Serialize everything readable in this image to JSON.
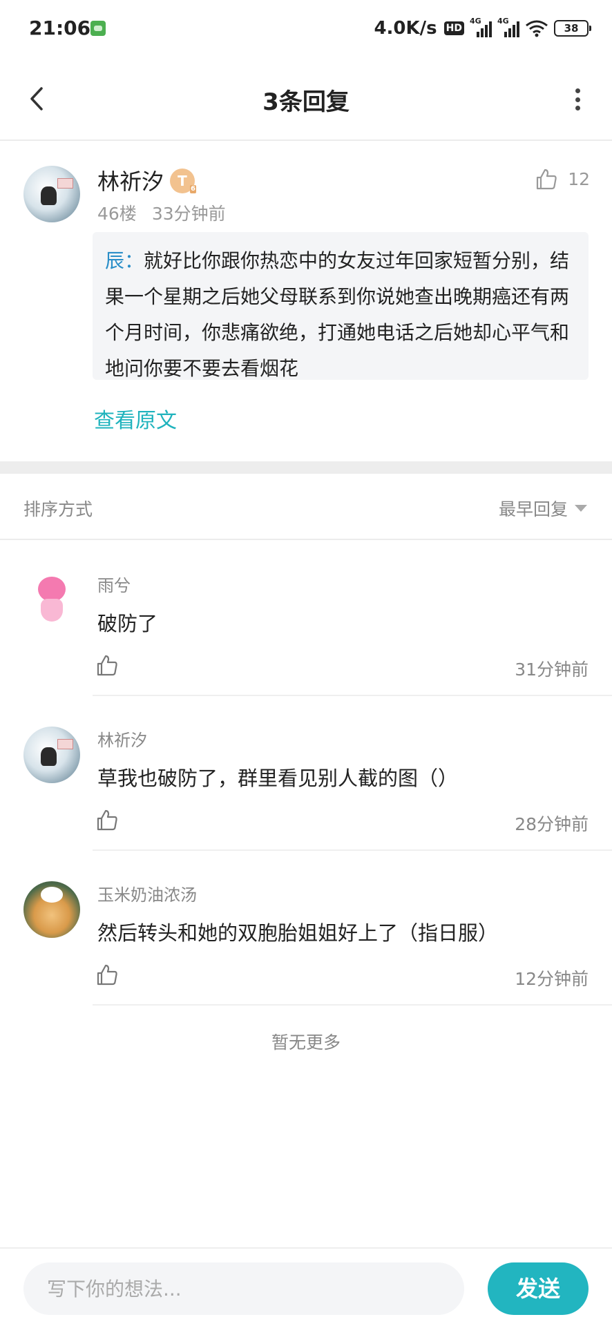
{
  "status_bar": {
    "time": "21:06",
    "net_speed": "4.0K/s",
    "hd_label": "HD",
    "signal_1_label": "4G",
    "signal_2_label": "4G",
    "battery": "38",
    "icons": [
      "app-notification-icon",
      "hd-icon",
      "signal-icon",
      "signal-icon",
      "wifi-icon",
      "battery-icon"
    ]
  },
  "header": {
    "title": "3条回复",
    "back_icon": "chevron-left-icon",
    "more_icon": "more-vertical-icon"
  },
  "post": {
    "author": "林祈汐",
    "level_badge": "T",
    "level_sub": "6",
    "floor": "46楼",
    "time": "33分钟前",
    "like_count": "12",
    "quote_name": "辰：",
    "quote_text": "就好比你跟你热恋中的女友过年回家短暂分别，结果一个星期之后她父母联系到你说她查出晚期癌还有两个月时间，你悲痛欲绝，打通她电话之后她却心平气和地问你要不要去看烟花",
    "view_original": "查看原文"
  },
  "sort": {
    "label": "排序方式",
    "selected": "最早回复"
  },
  "replies": [
    {
      "name": "雨兮",
      "text": "破防了",
      "time": "31分钟前"
    },
    {
      "name": "林祈汐",
      "text": "草我也破防了，群里看见别人截的图（）",
      "time": "28分钟前"
    },
    {
      "name": "玉米奶油浓汤",
      "text": "然后转头和她的双胞胎姐姐好上了（指日服）",
      "time": "12分钟前"
    }
  ],
  "no_more": "暂无更多",
  "composer": {
    "placeholder": "写下你的想法...",
    "send_label": "发送"
  },
  "colors": {
    "accent": "#22b5c0",
    "link": "#1fb3bd",
    "quote_name": "#2a8ec8",
    "muted": "#888888"
  }
}
